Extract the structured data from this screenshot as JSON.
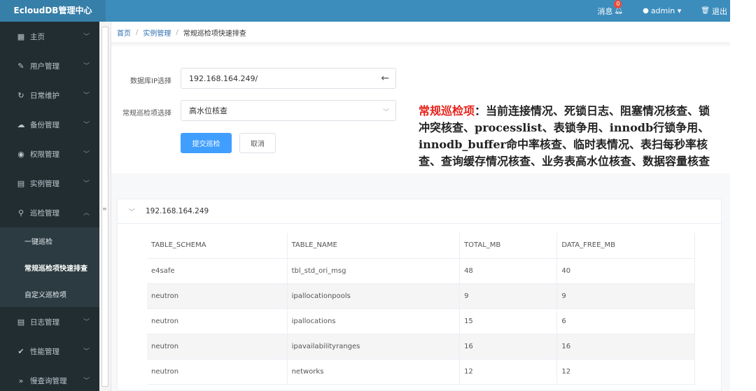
{
  "app": {
    "title": "EcloudDB管理中心"
  },
  "topbar": {
    "messages_label": "消息",
    "messages_badge": "0",
    "user_label": "admin ▾",
    "logout_label": "退出"
  },
  "sidebar": {
    "items": [
      {
        "label": "主页",
        "icon": "▦"
      },
      {
        "label": "用户管理",
        "icon": "✎"
      },
      {
        "label": "日常维护",
        "icon": "↻"
      },
      {
        "label": "备份管理",
        "icon": "☁"
      },
      {
        "label": "权限管理",
        "icon": "◉"
      },
      {
        "label": "实例管理",
        "icon": "▤"
      },
      {
        "label": "巡检管理",
        "icon": "⚲",
        "expanded_chevron": "^"
      },
      {
        "label": "日志管理",
        "icon": "▤"
      },
      {
        "label": "性能管理",
        "icon": "✔"
      },
      {
        "label": "慢查询管理",
        "icon": "»"
      }
    ],
    "sub_items": [
      {
        "label": "一键巡检"
      },
      {
        "label": "常规巡检项快速排查"
      },
      {
        "label": "自定义巡检项"
      }
    ]
  },
  "breadcrumb": {
    "home": "首页",
    "instance": "实例管理",
    "current": "常规巡检项快速排查"
  },
  "form": {
    "db_ip_label": "数据库IP选择",
    "db_ip_value": "192.168.164.249/",
    "check_label": "常规巡检项选择",
    "check_value": "高水位核查",
    "submit_label": "提交巡检",
    "cancel_label": "取消"
  },
  "annotation": {
    "highlight": "常规巡检项",
    "text": "：当前连接情况、死锁日志、阻塞情况核查、锁冲突核查、processlist、表锁争用、innodb行锁争用、innodb_buffer命中率核查、临时表情况、表扫每秒率核查、查询缓存情况核查、业务表高水位核查、数据容量核查"
  },
  "result": {
    "host": "192.168.164.249",
    "columns": [
      "TABLE_SCHEMA",
      "TABLE_NAME",
      "TOTAL_MB",
      "DATA_FREE_MB"
    ],
    "rows": [
      [
        "e4safe",
        "tbl_std_ori_msg",
        "48",
        "40"
      ],
      [
        "neutron",
        "ipallocationpools",
        "9",
        "9"
      ],
      [
        "neutron",
        "ipallocations",
        "15",
        "6"
      ],
      [
        "neutron",
        "ipavailabilityranges",
        "16",
        "16"
      ],
      [
        "neutron",
        "networks",
        "12",
        "12"
      ]
    ]
  }
}
